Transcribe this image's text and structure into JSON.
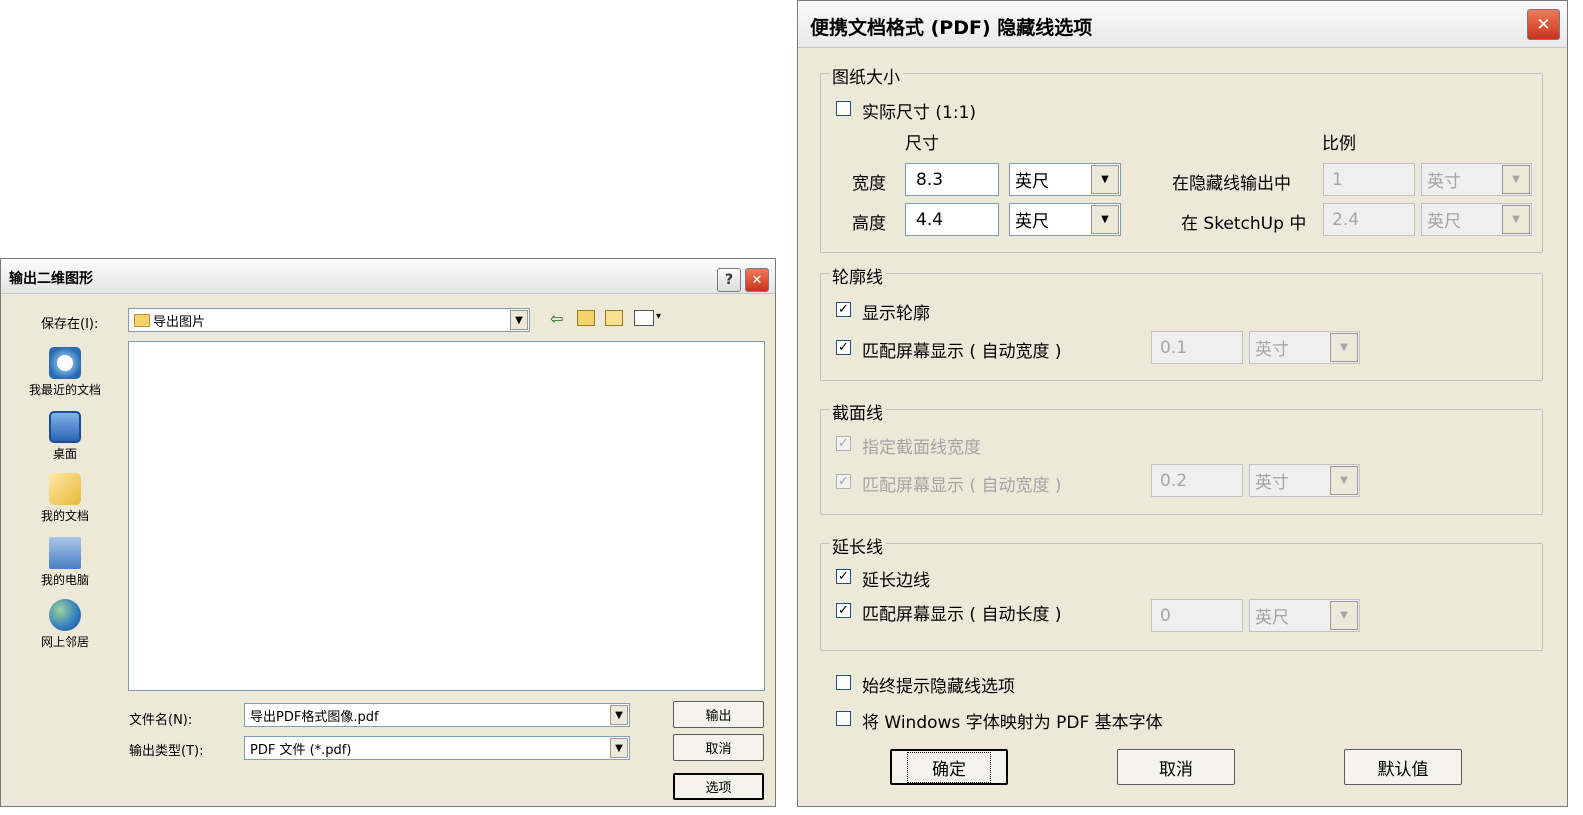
{
  "export_dialog": {
    "title": "输出二维图形",
    "help_label": "?",
    "close_label": "✕",
    "save_in_label": "保存在(I):",
    "save_in_value": "导出图片",
    "places": [
      {
        "label": "我最近的文档",
        "icon": "recent-docs-icon"
      },
      {
        "label": "桌面",
        "icon": "desktop-icon"
      },
      {
        "label": "我的文档",
        "icon": "my-documents-icon"
      },
      {
        "label": "我的电脑",
        "icon": "my-computer-icon"
      },
      {
        "label": "网上邻居",
        "icon": "network-places-icon"
      }
    ],
    "filename_label": "文件名(N):",
    "filename_value": "导出PDF格式图像.pdf",
    "filetype_label": "输出类型(T):",
    "filetype_value": "PDF 文件 (*.pdf)",
    "export_button": "输出",
    "cancel_button": "取消",
    "options_button": "选项"
  },
  "pdf_dialog": {
    "title": "便携文档格式 (PDF) 隐藏线选项",
    "close_label": "✕",
    "paper_size": {
      "group_title": "图纸大小",
      "actual_size_label": "实际尺寸 (1:1)",
      "actual_size_checked": false,
      "size_header": "尺寸",
      "scale_header": "比例",
      "width_label": "宽度",
      "width_value": "8.3",
      "width_unit": "英尺",
      "height_label": "高度",
      "height_value": "4.4",
      "height_unit": "英尺",
      "hidden_output_label": "在隐藏线输出中",
      "hidden_output_value": "1",
      "hidden_output_unit": "英寸",
      "in_sketchup_label": "在 SketchUp 中",
      "in_sketchup_value": "2.4",
      "in_sketchup_unit": "英尺"
    },
    "profile": {
      "group_title": "轮廓线",
      "show_profile_label": "显示轮廓",
      "show_profile_checked": true,
      "match_screen_label": "匹配屏幕显示 ( 自动宽度 )",
      "match_screen_checked": true,
      "value": "0.1",
      "unit": "英寸"
    },
    "section": {
      "group_title": "截面线",
      "specify_width_label": "指定截面线宽度",
      "specify_width_checked": true,
      "match_screen_label": "匹配屏幕显示 ( 自动宽度 )",
      "match_screen_checked": true,
      "value": "0.2",
      "unit": "英寸"
    },
    "extension": {
      "group_title": "延长线",
      "extend_edges_label": "延长边线",
      "extend_edges_checked": true,
      "match_screen_label": "匹配屏幕显示 ( 自动长度 )",
      "match_screen_checked": true,
      "value": "0",
      "unit": "英尺"
    },
    "always_prompt_label": "始终提示隐藏线选项",
    "always_prompt_checked": false,
    "map_fonts_label": "将 Windows 字体映射为 PDF 基本字体",
    "map_fonts_checked": false,
    "ok_button": "确定",
    "cancel_button": "取消",
    "default_button": "默认值",
    "check_mark": "✓"
  }
}
